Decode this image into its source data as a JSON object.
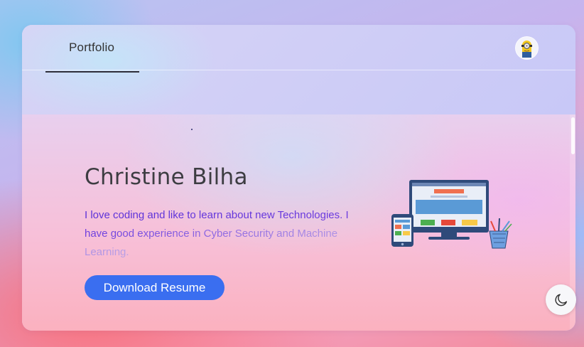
{
  "nav": {
    "tab_label": "Portfolio",
    "avatar_icon": "minion-avatar-icon"
  },
  "hero": {
    "name": "Christine Bilha",
    "bio": "I love coding and like to learn about new Technologies. I have good experience in Cyber Security and Machine Learning.",
    "download_label": "Download Resume",
    "illustration_icon": "devices-illustration-icon"
  },
  "theme_toggle": {
    "icon": "moon-icon"
  },
  "colors": {
    "accent": "#3a6ef0",
    "bio_text": "#5a34d6",
    "heading": "#3d3d42"
  }
}
